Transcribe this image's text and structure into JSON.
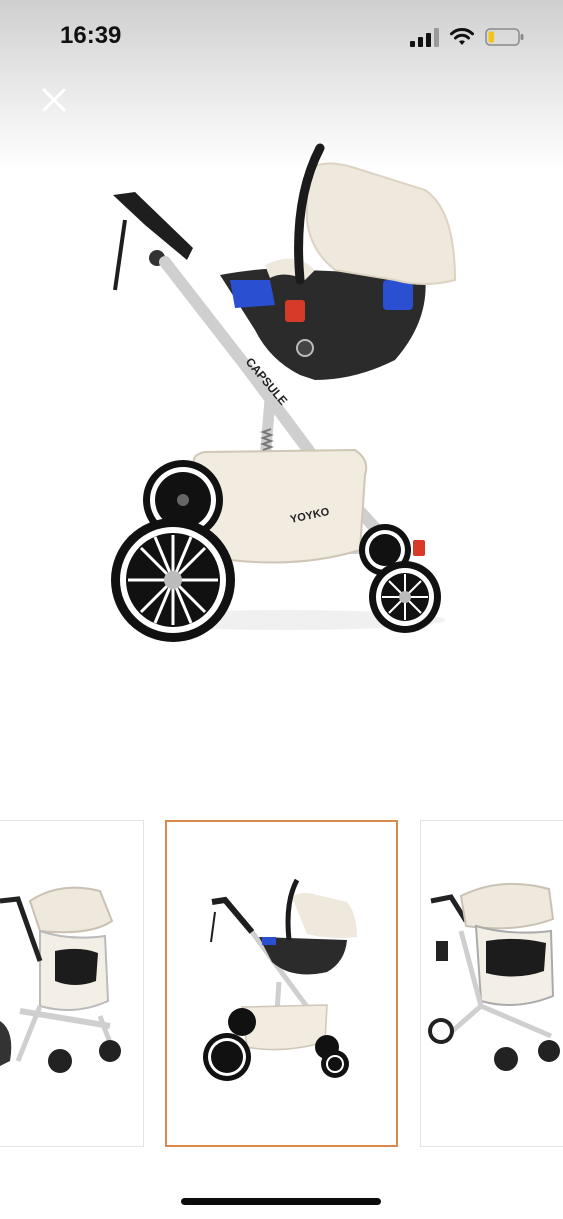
{
  "status_bar": {
    "time": "16:39",
    "signal_icon": "cellular-signal-icon",
    "wifi_icon": "wifi-icon",
    "battery_icon": "battery-low-icon",
    "battery_level": 0.2
  },
  "viewer": {
    "close_icon": "close-icon",
    "hero_image": {
      "description_icon": "stroller-product-photo",
      "brand_label": "YOYKO",
      "seat_label": "CAPSULE"
    },
    "thumbnails": [
      {
        "position": "previous",
        "selected": false
      },
      {
        "position": "current",
        "selected": true
      },
      {
        "position": "next",
        "selected": false
      }
    ]
  },
  "colors": {
    "selected_border": "#d9874a",
    "canopy": "#efe8dc",
    "frame": "#c8c8c8",
    "seat_shell": "#2b2b2b",
    "accent_blue": "#2a4fd0",
    "accent_red": "#d83a2a"
  }
}
